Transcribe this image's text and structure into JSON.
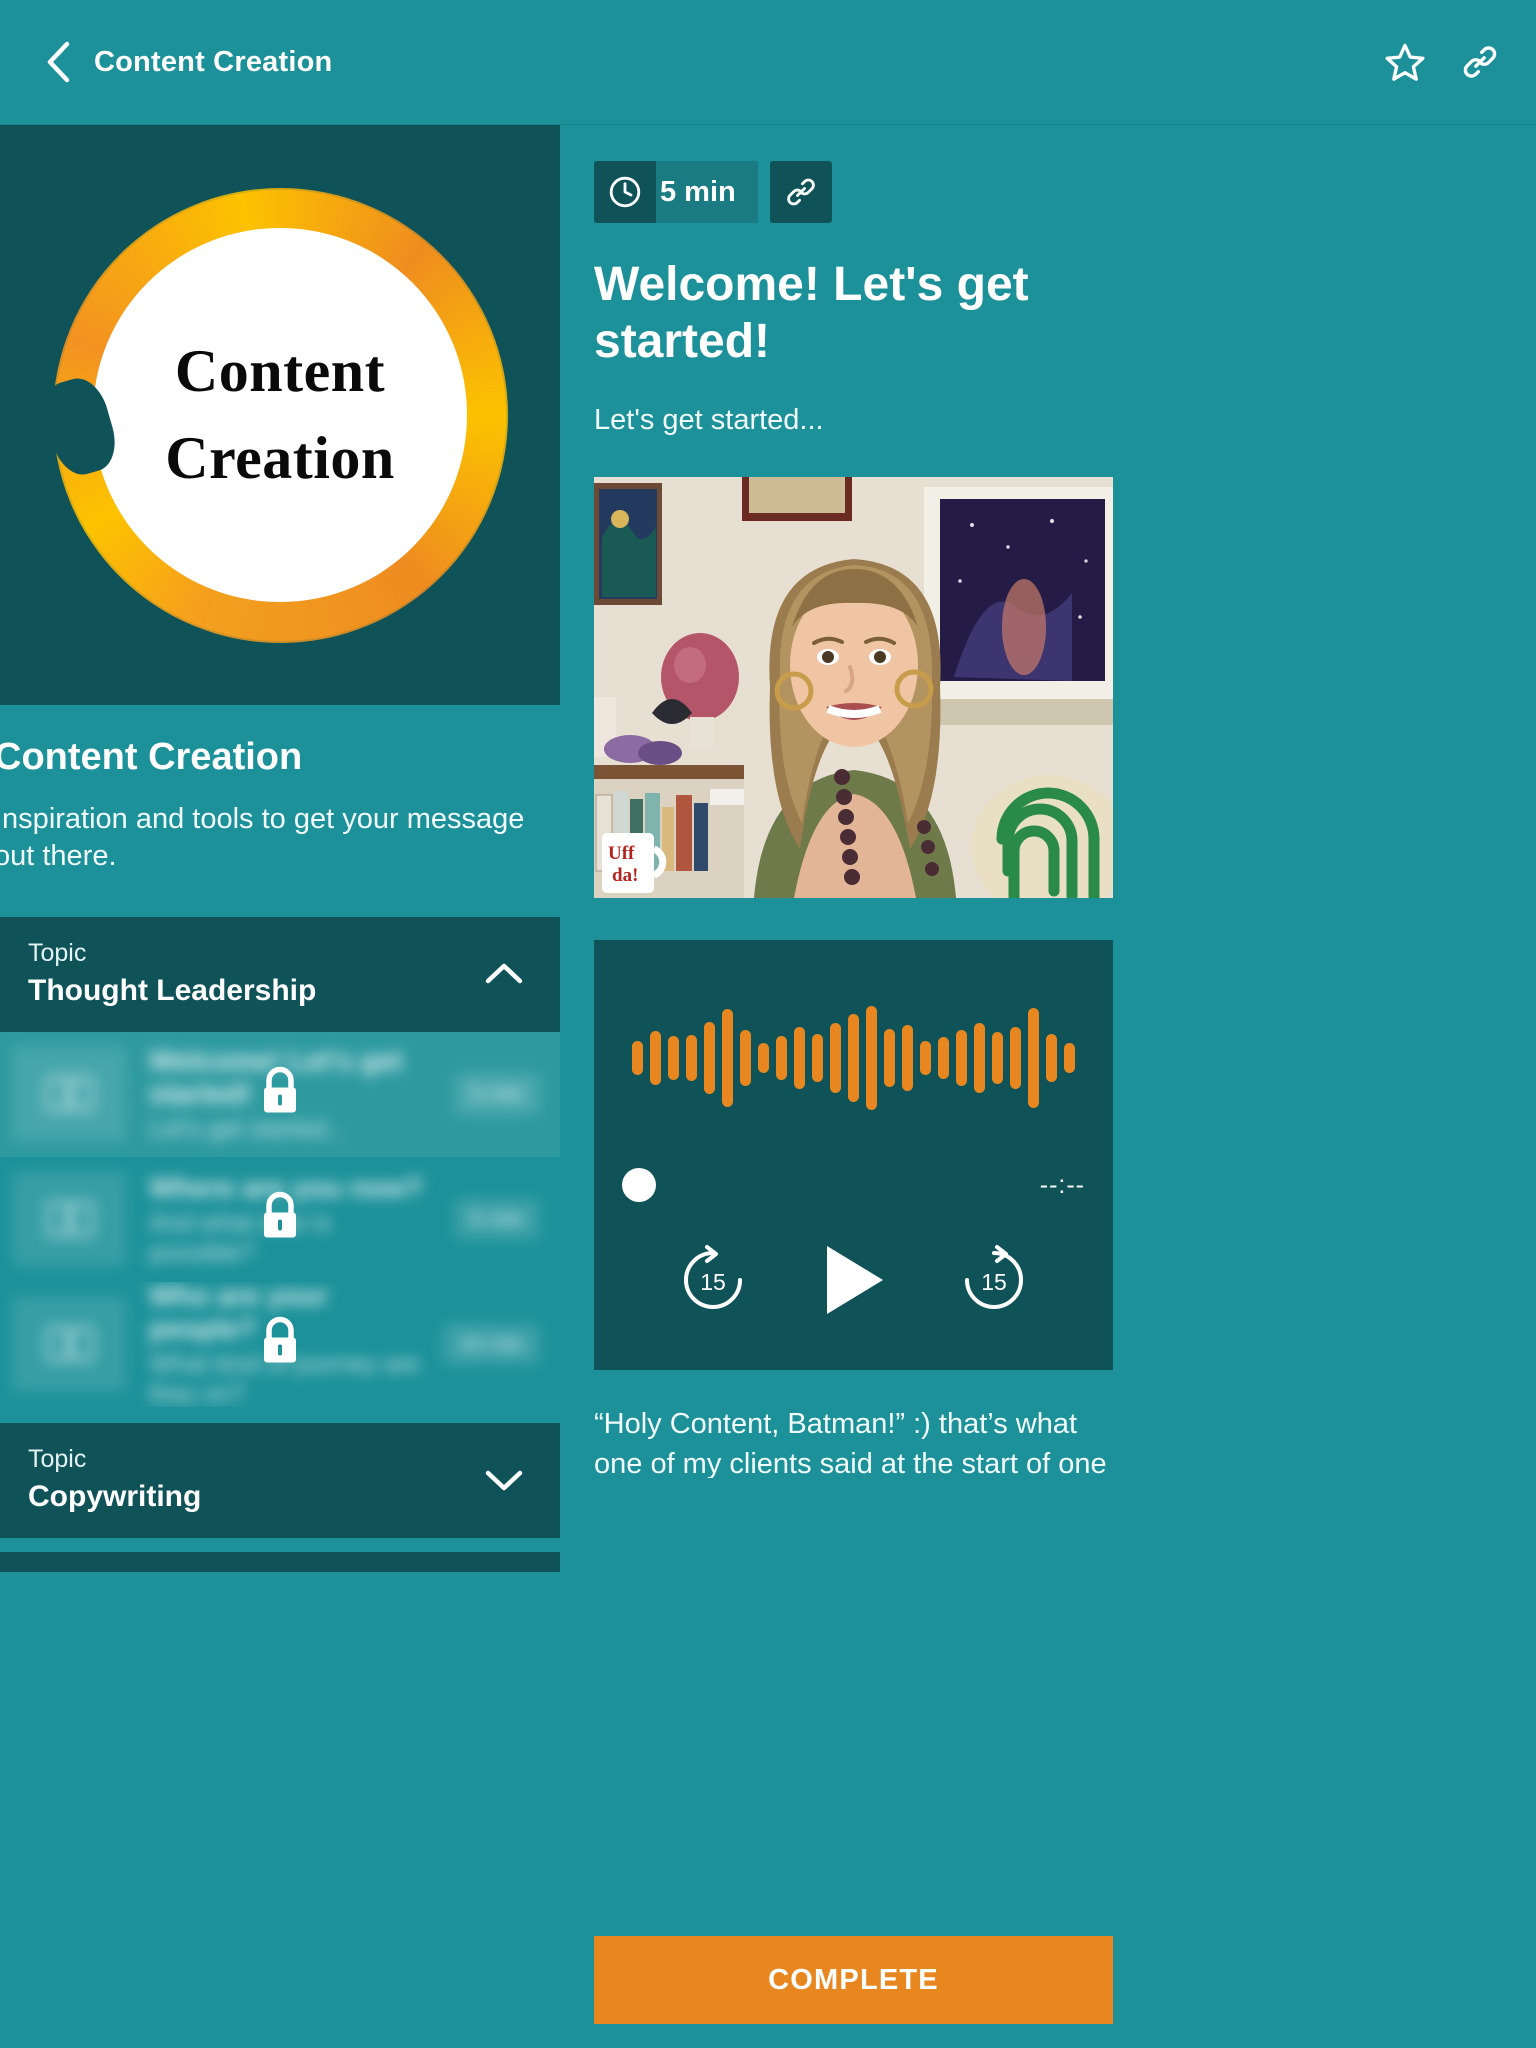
{
  "topbar": {
    "title": "Content Creation",
    "back_icon": "chevron-left-icon",
    "favorite_icon": "star-icon",
    "link_icon": "link-icon"
  },
  "colors": {
    "background_teal": "#1c9199",
    "panel_dark_teal": "#0f5359",
    "accent_orange": "#e8871f",
    "text_white": "#ffffff"
  },
  "course": {
    "logo_line1": "Content",
    "logo_line2": "Creation",
    "title": "Content Creation",
    "description": "Inspiration and tools to get your message out there."
  },
  "topics": [
    {
      "kicker": "Topic",
      "name": "Thought Leadership",
      "expanded": true,
      "chevron_icon": "chevron-up-icon",
      "lessons": [
        {
          "title": "Welcome! Let's get started!",
          "subtitle": "Let's get started...",
          "duration": "5 min",
          "locked": true,
          "current": true,
          "lock_icon": "lock-icon",
          "thumb_icon": "book-icon"
        },
        {
          "title": "Where are you now?",
          "subtitle": "And what else is possible?",
          "duration": "5 min",
          "locked": true,
          "current": false,
          "lock_icon": "lock-icon",
          "thumb_icon": "book-icon"
        },
        {
          "title": "Who are your people?",
          "subtitle": "What kind of journey are they on?",
          "duration": "10 min",
          "locked": true,
          "current": false,
          "lock_icon": "lock-icon",
          "thumb_icon": "book-icon"
        }
      ]
    },
    {
      "kicker": "Topic",
      "name": "Copywriting",
      "expanded": false,
      "chevron_icon": "chevron-down-icon",
      "lessons": []
    }
  ],
  "lesson": {
    "duration_badge": "5 min",
    "clock_icon": "clock-icon",
    "link_icon": "link-icon",
    "heading": "Welcome! Let's get started!",
    "description": "Let's get started...",
    "video_alt": "instructor-video-thumbnail",
    "quote": "“Holy Content, Batman!” :) that’s what one of my clients said at the start of one of my programs.",
    "complete_label": "COMPLETE"
  },
  "player": {
    "play_icon": "play-icon",
    "rewind_label": "15",
    "forward_label": "15",
    "rewind_icon": "rewind-15-icon",
    "forward_icon": "forward-15-icon",
    "elapsed_time": "--:--",
    "waveform": [
      34,
      54,
      44,
      46,
      72,
      98,
      56,
      30,
      44,
      62,
      48,
      70,
      88,
      104,
      58,
      66,
      34,
      42,
      56,
      70,
      52,
      62,
      100,
      48,
      30
    ]
  }
}
